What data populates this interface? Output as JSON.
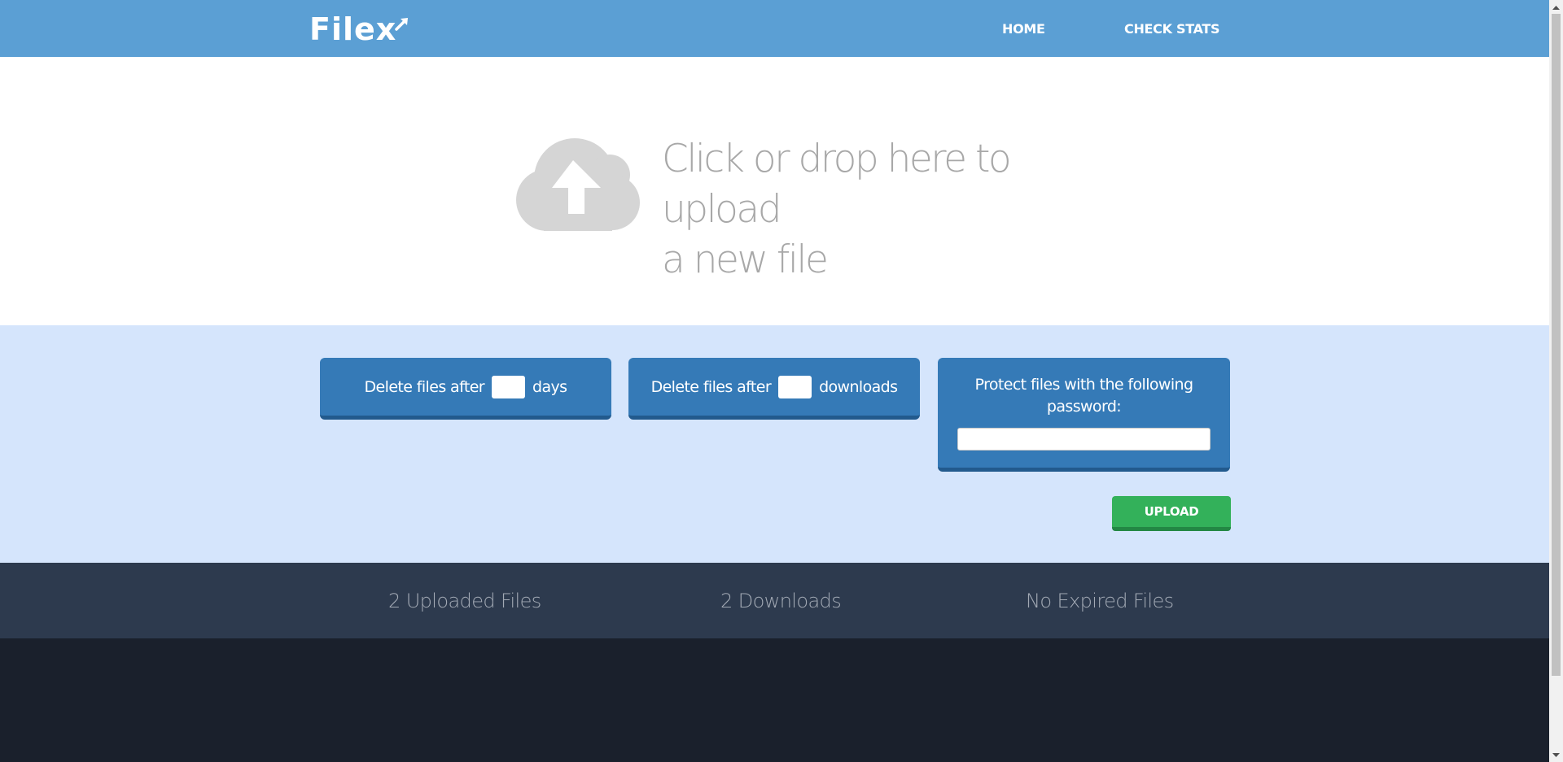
{
  "header": {
    "logo_text": "Filex",
    "nav": {
      "home": "HOME",
      "check_stats": "CHECK STATS"
    }
  },
  "upload_zone": {
    "icon": "cloud-upload-icon",
    "line1": "Click or drop here to upload",
    "line2": "a new file"
  },
  "options": {
    "days": {
      "prefix": "Delete files after",
      "suffix": "days",
      "value": ""
    },
    "downloads": {
      "prefix": "Delete files after",
      "suffix": "downloads",
      "value": ""
    },
    "password": {
      "label": "Protect files with the following password:",
      "value": ""
    },
    "upload_button": "UPLOAD"
  },
  "stats": {
    "uploaded": "2 Uploaded Files",
    "downloads": "2 Downloads",
    "expired": "No Expired Files"
  },
  "colors": {
    "header": "#5b9fd4",
    "options_bg": "#d5e5fc",
    "card": "#357ab7",
    "upload_button": "#33b15a",
    "stats_bg": "#2d3a4e",
    "footer_bg": "#1a202c",
    "upload_text": "#a8a8a8"
  }
}
